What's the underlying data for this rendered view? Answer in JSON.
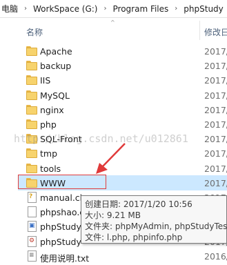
{
  "breadcrumb": {
    "items": [
      "电脑",
      "WorkSpace (G:)",
      "Program Files",
      "phpStudy"
    ],
    "separator": "›"
  },
  "columns": {
    "name": "名称",
    "date": "修改日"
  },
  "files": [
    {
      "name": "Apache",
      "date": "2017/",
      "type": "folder"
    },
    {
      "name": "backup",
      "date": "2017/",
      "type": "folder"
    },
    {
      "name": "IIS",
      "date": "2017/",
      "type": "folder"
    },
    {
      "name": "MySQL",
      "date": "2017/",
      "type": "folder"
    },
    {
      "name": "nginx",
      "date": "2017/",
      "type": "folder"
    },
    {
      "name": "php",
      "date": "2017/",
      "type": "folder"
    },
    {
      "name": "SQL-Front",
      "date": "2017/",
      "type": "folder"
    },
    {
      "name": "tmp",
      "date": "2017/",
      "type": "folder"
    },
    {
      "name": "tools",
      "date": "2017/",
      "type": "folder"
    },
    {
      "name": "WWW",
      "date": "2017/",
      "type": "folder",
      "selected": true
    },
    {
      "name": "manual.ch",
      "date": "2017/",
      "type": "help"
    },
    {
      "name": "phpshao.c",
      "date": "2017/",
      "type": "file"
    },
    {
      "name": "phpStudy.",
      "date": "2017/",
      "type": "exe"
    },
    {
      "name": "phpStudy",
      "date": "2017/",
      "type": "ini"
    },
    {
      "name": "使用说明.txt",
      "date": "2016/",
      "type": "txt"
    }
  ],
  "tooltip": {
    "created": "创建日期: 2017/1/20 10:56",
    "size": "大小: 9.21 MB",
    "folders": "文件夹: phpMyAdmin, phpStudyTest",
    "files": "文件: l.php, phpinfo.php"
  },
  "watermark": "http://blog.csdn.net/u012861",
  "colors": {
    "selection": "#cce8ff",
    "highlight": "#e03a3a",
    "folder": "#f7d36d"
  }
}
